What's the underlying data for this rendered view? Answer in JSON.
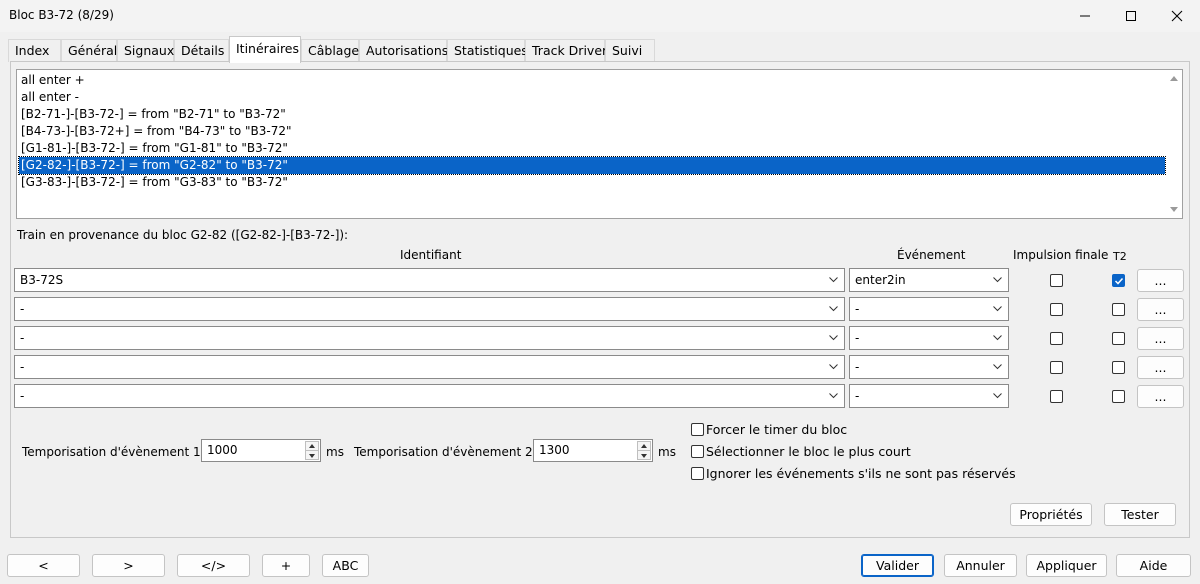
{
  "window": {
    "title": "Bloc B3-72 (8/29)"
  },
  "tabs": [
    {
      "label": "Index",
      "active": false
    },
    {
      "label": "Général",
      "active": false
    },
    {
      "label": "Signaux",
      "active": false
    },
    {
      "label": "Détails",
      "active": false
    },
    {
      "label": "Itinéraires",
      "active": true
    },
    {
      "label": "Câblage",
      "active": false
    },
    {
      "label": "Autorisations",
      "active": false
    },
    {
      "label": "Statistiques",
      "active": false
    },
    {
      "label": "Track Driver",
      "active": false
    },
    {
      "label": "Suivi",
      "active": false
    }
  ],
  "routes": {
    "items": [
      "all enter +",
      "all enter -",
      "[B2-71-]-[B3-72-] = from \"B2-71\" to \"B3-72\"",
      "[B4-73-]-[B3-72+] = from \"B4-73\" to \"B3-72\"",
      "[G1-81-]-[B3-72-] = from \"G1-81\" to \"B3-72\"",
      "[G2-82-]-[B3-72-] = from \"G2-82\" to \"B3-72\"",
      "[G3-83-]-[B3-72-] = from \"G3-83\" to \"B3-72\""
    ],
    "selected": "[G2-82-]-[B3-72-] = from \"G2-82\" to \"B3-72\""
  },
  "section_label": "Train en provenance du bloc G2-82 ([G2-82-]-[B3-72-]):",
  "grid": {
    "headers": {
      "identifiant": "Identifiant",
      "evenement": "Événement",
      "impulsion": "Impulsion finale",
      "t2": "T2"
    },
    "rows": [
      {
        "identifiant": "B3-72S",
        "evenement": "enter2in",
        "impulsion": false,
        "t2": true,
        "more": "..."
      },
      {
        "identifiant": "-",
        "evenement": "-",
        "impulsion": false,
        "t2": false,
        "more": "..."
      },
      {
        "identifiant": "-",
        "evenement": "-",
        "impulsion": false,
        "t2": false,
        "more": "..."
      },
      {
        "identifiant": "-",
        "evenement": "-",
        "impulsion": false,
        "t2": false,
        "more": "..."
      },
      {
        "identifiant": "-",
        "evenement": "-",
        "impulsion": false,
        "t2": false,
        "more": "..."
      }
    ]
  },
  "timers": {
    "label1": "Temporisation d'évènement 1",
    "value1": "1000",
    "unit1": "ms",
    "label2": "Temporisation d'évènement 2",
    "value2": "1300",
    "unit2": "ms"
  },
  "options": [
    {
      "label": "Forcer le timer du bloc",
      "checked": false
    },
    {
      "label": "Sélectionner le bloc le plus court",
      "checked": false
    },
    {
      "label": "Ignorer les événements s'ils ne sont pas réservés",
      "checked": false
    }
  ],
  "panel_buttons": {
    "proprietes": "Propriétés",
    "tester": "Tester"
  },
  "footer": {
    "prev": "<",
    "next": ">",
    "code": "</>",
    "plus": "+",
    "abc": "ABC",
    "valider": "Valider",
    "annuler": "Annuler",
    "appliquer": "Appliquer",
    "aide": "Aide"
  },
  "colors": {
    "selection": "#0a64c8",
    "background": "#f0f0f0"
  }
}
